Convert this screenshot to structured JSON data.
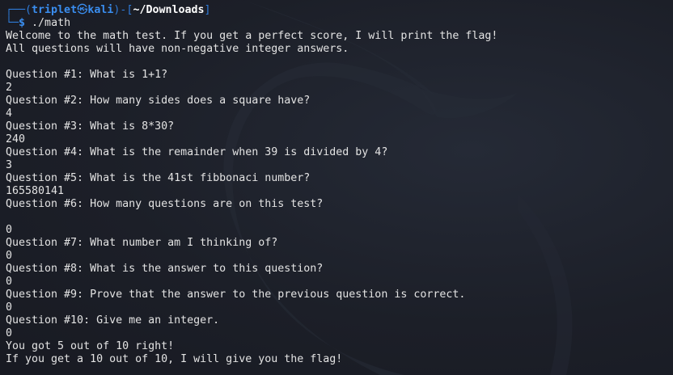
{
  "prompt": {
    "user": "triplet",
    "host": "kali",
    "skull_glyph": "㉿",
    "path": "~/Downloads",
    "symbol": "$",
    "command": "./math"
  },
  "output": [
    "Welcome to the math test. If you get a perfect score, I will print the flag!",
    "All questions will have non-negative integer answers.",
    "",
    "Question #1: What is 1+1?",
    "2",
    "Question #2: How many sides does a square have?",
    "4",
    "Question #3: What is 8*30?",
    "240",
    "Question #4: What is the remainder when 39 is divided by 4?",
    "3",
    "Question #5: What is the 41st fibbonaci number?",
    "165580141",
    "Question #6: How many questions are on this test?",
    "",
    "0",
    "Question #7: What number am I thinking of?",
    "0",
    "Question #8: What is the answer to this question?",
    "0",
    "Question #9: Prove that the answer to the previous question is correct.",
    "0",
    "Question #10: Give me an integer.",
    "0",
    "You got 5 out of 10 right!",
    "If you get a 10 out of 10, I will give you the flag!"
  ],
  "colors": {
    "background": "#1c1f28",
    "prompt_blue": "#3a8ef0",
    "text": "#e3e3e3"
  }
}
